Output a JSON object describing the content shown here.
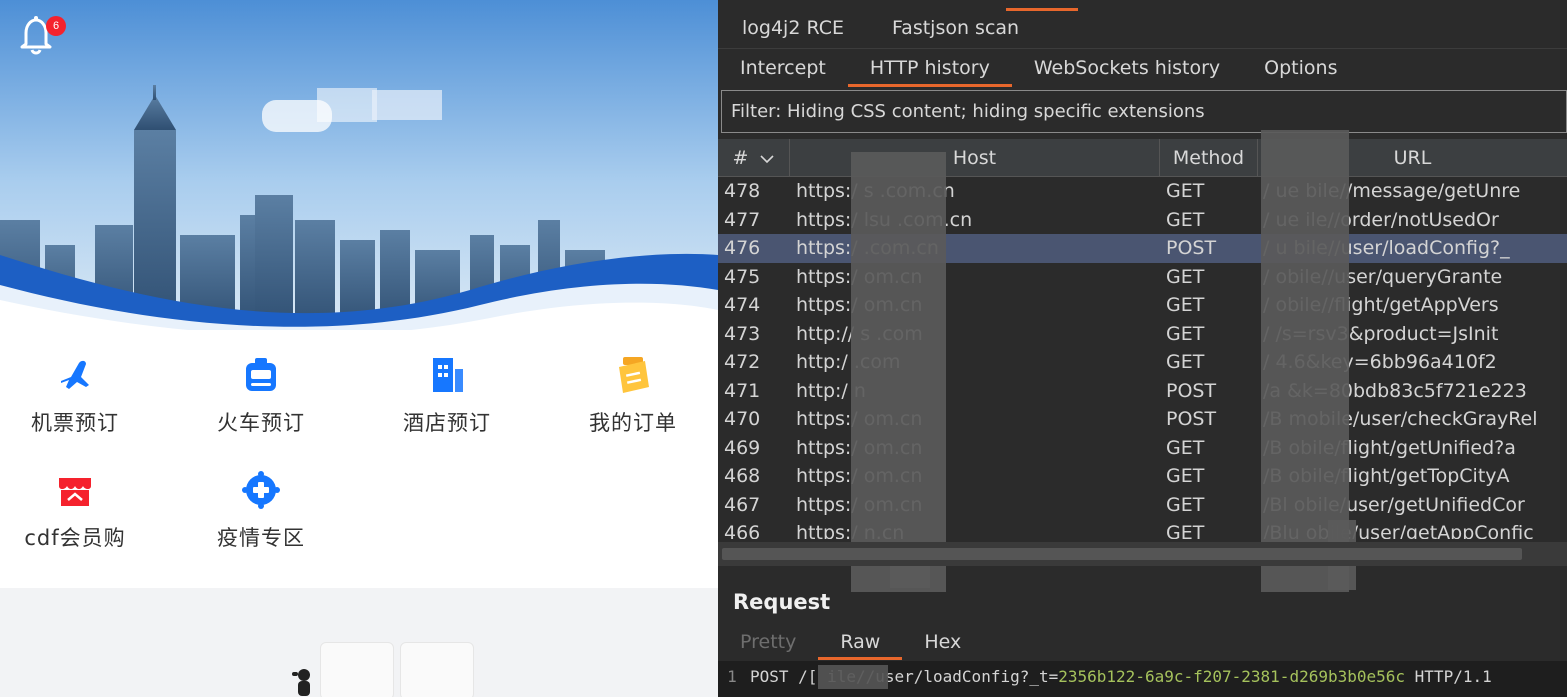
{
  "app": {
    "notification_count": "6",
    "grid": [
      {
        "label": "机票预订",
        "icon": "plane-icon"
      },
      {
        "label": "火车预订",
        "icon": "train-icon"
      },
      {
        "label": "酒店预订",
        "icon": "hotel-icon"
      },
      {
        "label": "我的订单",
        "icon": "orders-icon"
      },
      {
        "label": "cdf会员购",
        "icon": "member-shop-icon"
      },
      {
        "label": "疫情专区",
        "icon": "epidemic-icon"
      }
    ]
  },
  "burp": {
    "ext_tabs": [
      "log4j2 RCE",
      "Fastjson scan"
    ],
    "proxy_tabs": [
      "Intercept",
      "HTTP history",
      "WebSockets history",
      "Options"
    ],
    "proxy_active": "HTTP history",
    "filter_text": "Filter: Hiding CSS content;  hiding specific extensions",
    "columns": [
      "#",
      "Host",
      "Method",
      "URL"
    ],
    "rows": [
      {
        "num": "478",
        "host": "https:/            s    .com.cn",
        "method": "GET",
        "url": "/  ue         bile//message/getUnre"
      },
      {
        "num": "477",
        "host": "https:/           lsu  .com.cn",
        "method": "GET",
        "url": "/  ue          ile//order/notUsedOr"
      },
      {
        "num": "476",
        "host": "https:/              .com.cn",
        "method": "POST",
        "url": "/  u          bile//user/loadConfig?_"
      },
      {
        "num": "475",
        "host": "https:/              om.cn",
        "method": "GET",
        "url": "/           obile//user/queryGrante"
      },
      {
        "num": "474",
        "host": "https:/              om.cn",
        "method": "GET",
        "url": "/           obile//flight/getAppVers"
      },
      {
        "num": "473",
        "host": "http://  s             .com",
        "method": "GET",
        "url": "/             /s=rsv3&product=JsInit"
      },
      {
        "num": "472",
        "host": "http:/                .com",
        "method": "GET",
        "url": "/           4.6&key=6bb96a410f2"
      },
      {
        "num": "471",
        "host": "http:/                n",
        "method": "POST",
        "url": "/a           &k=80bdb83c5f721e223"
      },
      {
        "num": "470",
        "host": "https:/              om.cn",
        "method": "POST",
        "url": "/B        mobile/user/checkGrayRel"
      },
      {
        "num": "469",
        "host": "https:/              om.cn",
        "method": "GET",
        "url": "/B         obile/flight/getUnified?a"
      },
      {
        "num": "468",
        "host": "https:/              om.cn",
        "method": "GET",
        "url": "/B         obile/flight/getTopCityA"
      },
      {
        "num": "467",
        "host": "https:/              om.cn",
        "method": "GET",
        "url": "/Bl        obile/user/getUnifiedCor"
      },
      {
        "num": "466",
        "host": "https:/              n.cn",
        "method": "GET",
        "url": "/Blu       obile/user/getAppConfic"
      }
    ],
    "selected_row": "476",
    "request_title": "Request",
    "req_tabs": [
      "Pretty",
      "Raw",
      "Hex"
    ],
    "req_active": "Raw",
    "editor": {
      "line1_no": "1",
      "line1_prefix": "POST /[            ile//user/loadConfig?_t=",
      "line1_token": "2356b122-6a9c-f207-2381-d269b3b0e56c",
      "line1_suffix": " HTTP/1.1"
    }
  }
}
